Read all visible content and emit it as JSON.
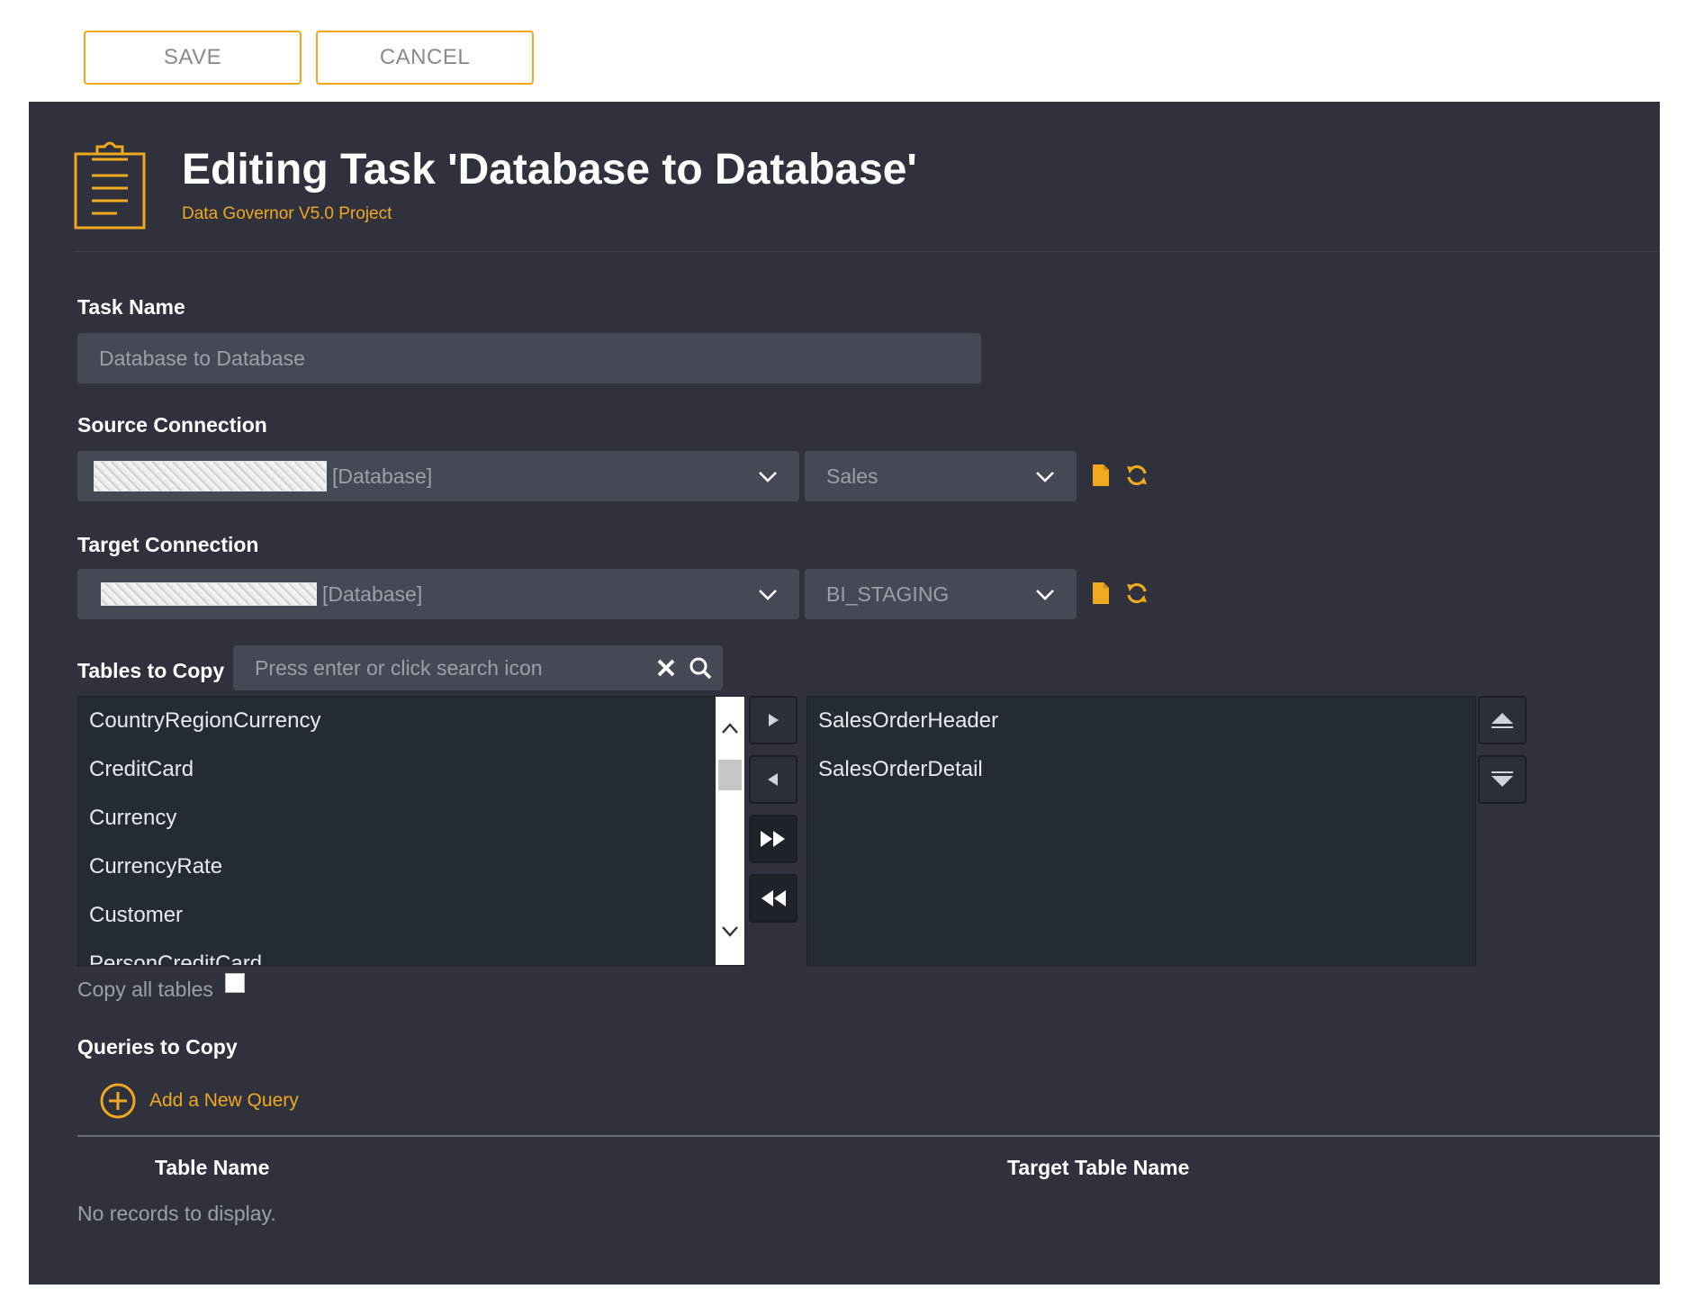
{
  "toolbar": {
    "save_label": "SAVE",
    "cancel_label": "CANCEL"
  },
  "header": {
    "title": "Editing Task 'Database to Database'",
    "subtitle": "Data Governor V5.0 Project",
    "icon": "clipboard-icon"
  },
  "task_name": {
    "label": "Task Name",
    "value": "Database to Database"
  },
  "source_connection": {
    "label": "Source Connection",
    "connection_suffix": "[Database]",
    "schema_value": "Sales"
  },
  "target_connection": {
    "label": "Target Connection",
    "connection_suffix": "[Database]",
    "schema_value": "BI_STAGING"
  },
  "tables": {
    "label": "Tables to Copy",
    "search_placeholder": "Press enter or click search icon",
    "available": [
      "CountryRegionCurrency",
      "CreditCard",
      "Currency",
      "CurrencyRate",
      "Customer",
      "PersonCreditCard"
    ],
    "selected": [
      "SalesOrderHeader",
      "SalesOrderDetail"
    ],
    "copy_all_label": "Copy all tables"
  },
  "queries": {
    "label": "Queries to Copy",
    "add_label": "Add a New Query",
    "columns": [
      "Table Name",
      "Target Table Name"
    ],
    "empty_message": "No records to display."
  },
  "colors": {
    "accent": "#f0a81e",
    "panel": "#2f323c",
    "field": "#444955",
    "list": "#252b33"
  }
}
